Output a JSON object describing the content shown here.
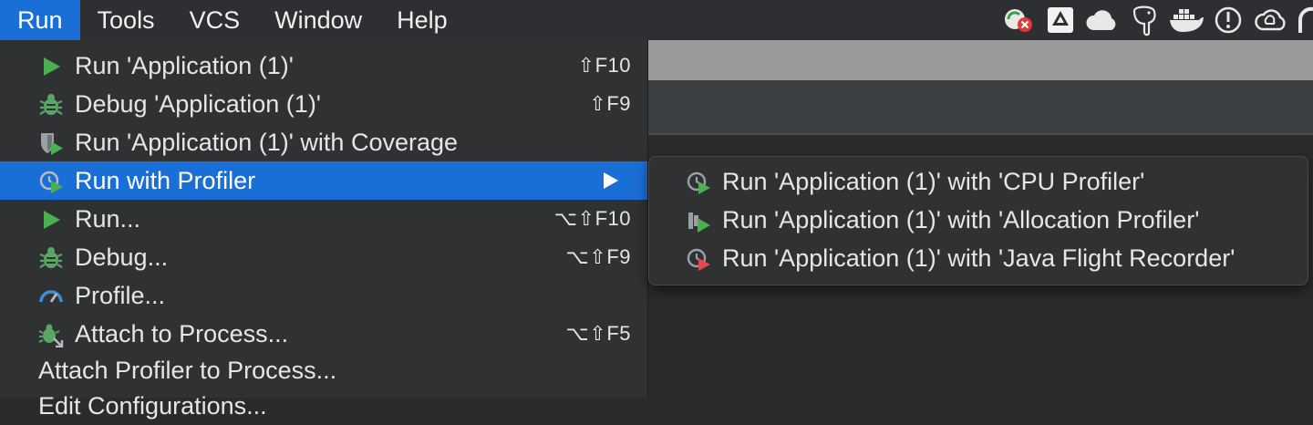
{
  "menubar": {
    "items": [
      {
        "label": "Run",
        "active": true
      },
      {
        "label": "Tools"
      },
      {
        "label": "VCS"
      },
      {
        "label": "Window"
      },
      {
        "label": "Help"
      }
    ],
    "tray_icons": [
      "sync-error-icon",
      "google-drive-icon",
      "cloud-icon",
      "elephant-icon",
      "docker-icon",
      "status-circle-icon",
      "creative-cloud-icon",
      "partial-icon"
    ]
  },
  "run_menu": {
    "items": [
      {
        "label": "Run 'Application (1)'",
        "shortcut": "⇧F10",
        "icon": "run-icon"
      },
      {
        "label": "Debug 'Application (1)'",
        "shortcut": "⇧F9",
        "icon": "debug-icon"
      },
      {
        "label": "Run 'Application (1)' with Coverage",
        "shortcut": "",
        "icon": "coverage-icon"
      },
      {
        "label": "Run with Profiler",
        "shortcut": "",
        "icon": "profiler-icon",
        "selected": true,
        "submenu": true
      },
      {
        "label": "Run...",
        "shortcut": "⌥⇧F10",
        "icon": "run-icon"
      },
      {
        "label": "Debug...",
        "shortcut": "⌥⇧F9",
        "icon": "debug-icon"
      },
      {
        "label": "Profile...",
        "shortcut": "",
        "icon": "gauge-icon"
      },
      {
        "label": "Attach to Process...",
        "shortcut": "⌥⇧F5",
        "icon": "attach-debug-icon"
      },
      {
        "label": "Attach Profiler to Process...",
        "shortcut": "",
        "icon": ""
      },
      {
        "label": "Edit Configurations...",
        "shortcut": "",
        "icon": ""
      }
    ]
  },
  "profiler_submenu": {
    "items": [
      {
        "label": "Run 'Application (1)' with 'CPU Profiler'",
        "icon": "cpu-profiler-icon"
      },
      {
        "label": "Run 'Application (1)' with 'Allocation Profiler'",
        "icon": "allocation-profiler-icon"
      },
      {
        "label": "Run 'Application (1)' with 'Java Flight Recorder'",
        "icon": "flight-recorder-icon"
      }
    ]
  },
  "colors": {
    "menubar_bg": "#2d2f32",
    "menu_bg": "#2f3133",
    "selection": "#1a6fd6",
    "run_green": "#4caf50",
    "debug_green": "#5aa564",
    "record_red": "#e5484d"
  }
}
